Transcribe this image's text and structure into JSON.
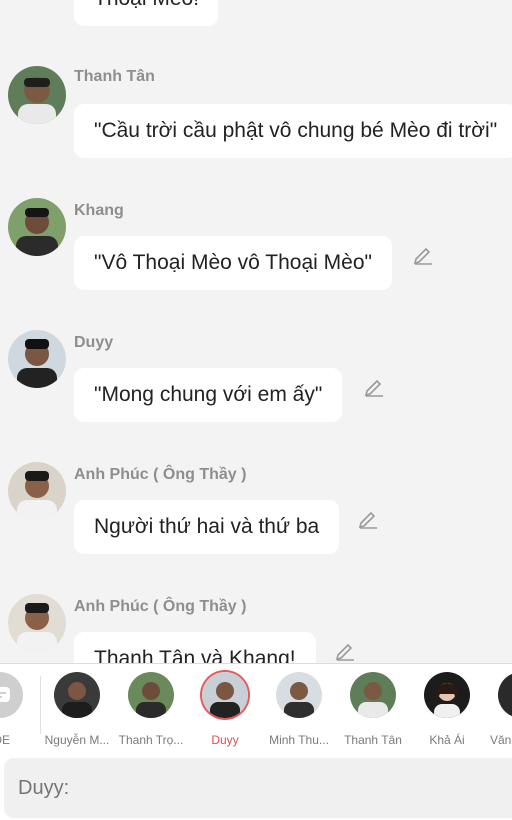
{
  "messages": [
    {
      "name": "",
      "text": "Thoại Mèo!"
    },
    {
      "name": "Thanh Tân",
      "text": "\"Cầu trời cầu phật vô chung bé Mèo đi trời\""
    },
    {
      "name": "Khang",
      "text": "\"Vô Thoại Mèo vô Thoại Mèo\""
    },
    {
      "name": "Duyy",
      "text": "\"Mong chung với em ấy\""
    },
    {
      "name": "Anh Phúc ( Ông Thầy )",
      "text": "Người thứ hai và thứ ba"
    },
    {
      "name": "Anh Phúc ( Ông Thầy )",
      "text": "Thanh Tân và Khang!"
    }
  ],
  "speakers": [
    {
      "label": "IDE"
    },
    {
      "label": "Nguyễn M..."
    },
    {
      "label": "Thanh Trọ..."
    },
    {
      "label": "Duyy",
      "active": true
    },
    {
      "label": "Minh Thu..."
    },
    {
      "label": "Thanh Tân"
    },
    {
      "label": "Khả Ái"
    },
    {
      "label": "Văn"
    }
  ],
  "input": {
    "placeholder": "Duyy:"
  },
  "colors": {
    "background": "#f3f3f3",
    "bubble": "#ffffff",
    "active": "#d9534f"
  }
}
